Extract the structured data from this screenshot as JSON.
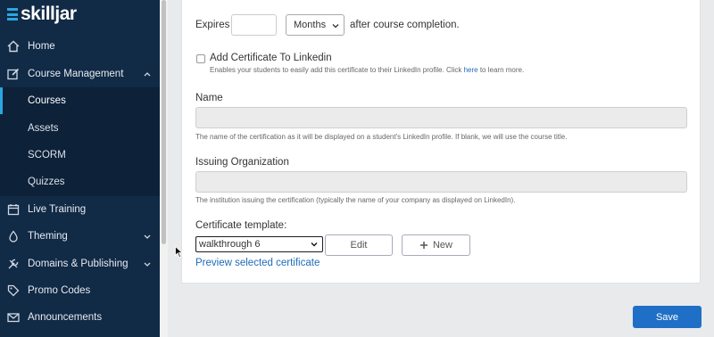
{
  "brand": {
    "logo_text": "skilljar"
  },
  "sidebar": {
    "items": [
      {
        "label": "Home",
        "icon": "home-icon"
      },
      {
        "label": "Course Management",
        "icon": "edit-icon"
      },
      {
        "label": "Live Training",
        "icon": "calendar-icon"
      },
      {
        "label": "Theming",
        "icon": "droplet-icon"
      },
      {
        "label": "Domains & Publishing",
        "icon": "tools-icon"
      },
      {
        "label": "Promo Codes",
        "icon": "tag-icon"
      },
      {
        "label": "Announcements",
        "icon": "envelope-icon"
      }
    ],
    "sub_items": [
      {
        "label": "Courses",
        "active": true
      },
      {
        "label": "Assets"
      },
      {
        "label": "SCORM"
      },
      {
        "label": "Quizzes"
      }
    ]
  },
  "form": {
    "expires": {
      "label": "Expires",
      "value": "",
      "unit": "Months",
      "suffix": "after course completion."
    },
    "linkedin": {
      "label": "Add Certificate To Linkedin",
      "help_prefix": "Enables your students to easily add this certificate to their LinkedIn profile. Click ",
      "help_link": "here",
      "help_suffix": " to learn more.",
      "checked": false
    },
    "name": {
      "label": "Name",
      "value": "",
      "help": "The name of the certification as it will be displayed on a student's LinkedIn profile. If blank, we will use the course title."
    },
    "issuing_org": {
      "label": "Issuing Organization",
      "value": "",
      "help": "The institution issuing the certification (typically the name of your company as displayed on LinkedIn)."
    },
    "template": {
      "label": "Certificate template:",
      "selected": "walkthrough 6",
      "edit_label": "Edit",
      "new_label": "New",
      "preview_link": "Preview selected certificate"
    }
  },
  "actions": {
    "save_label": "Save"
  },
  "colors": {
    "sidebar_bg": "#112a46",
    "accent": "#1f6fc6",
    "link": "#1e6bb8"
  }
}
